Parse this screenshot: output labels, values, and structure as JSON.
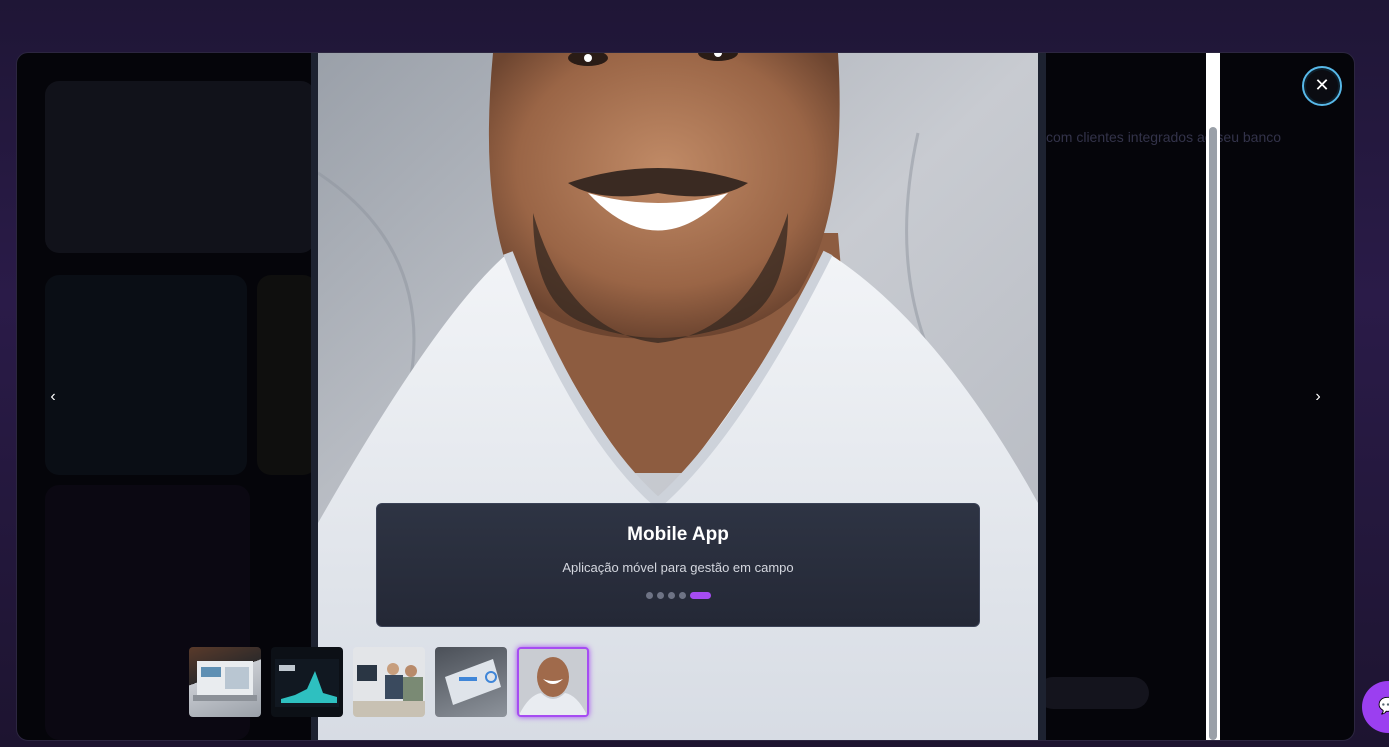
{
  "viewer": {
    "slide_title": "Mobile App",
    "slide_description": "Aplicação móvel para gestão em campo",
    "total_slides": 5,
    "active_slide": 5,
    "prev_icon": "chevron-left-icon",
    "next_icon": "chevron-right-icon",
    "prev_glyph": "‹",
    "next_glyph": "›",
    "close_icon": "close-icon",
    "close_glyph": "✕"
  },
  "thumbnails": [
    {
      "subject": "laptop-dashboard"
    },
    {
      "subject": "dark-dashboard-screen"
    },
    {
      "subject": "people-at-desk"
    },
    {
      "subject": "laptop-charts"
    },
    {
      "subject": "smiling-man-portrait"
    }
  ],
  "background": {
    "partial_text": "com clientes integrados ao seu banco"
  },
  "chat": {
    "icon": "chat-icon",
    "glyph": "💬"
  },
  "colors": {
    "accent": "#a64cf2",
    "focus_ring": "#57b8e8",
    "caption_bg": "#282e3e"
  }
}
